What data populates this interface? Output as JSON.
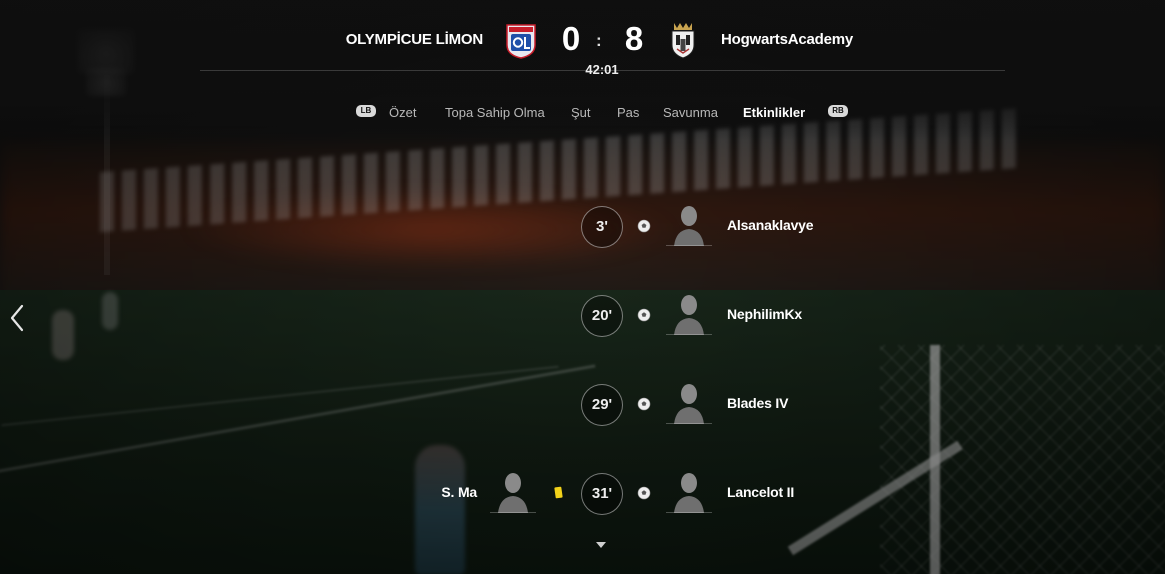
{
  "match": {
    "home_team": "OLYMPİCUE LİMON",
    "away_team": "HogwartsAcademy",
    "home_score": "0",
    "score_separator": ":",
    "away_score": "8",
    "clock": "42:01",
    "home_crest_icon": "lyon-crest-icon",
    "away_crest_icon": "castle-crest-icon"
  },
  "tabs": {
    "left_bumper": "LB",
    "right_bumper": "RB",
    "items": [
      {
        "label": "Özet"
      },
      {
        "label": "Topa Sahip Olma"
      },
      {
        "label": "Şut"
      },
      {
        "label": "Pas"
      },
      {
        "label": "Savunma"
      },
      {
        "label": "Etkinlikler"
      }
    ],
    "active_index": 5
  },
  "events": [
    {
      "minute": "3'",
      "type": "goal",
      "side": "away",
      "player": "Alsanaklavye"
    },
    {
      "minute": "20'",
      "type": "goal",
      "side": "away",
      "player": "NephilimKx"
    },
    {
      "minute": "29'",
      "type": "goal",
      "side": "away",
      "player": "Blades IV"
    },
    {
      "minute": "31'",
      "type": "goal",
      "side": "away",
      "player": "Lancelot II",
      "home_event": {
        "type": "yellow-card",
        "player": "S. Ma"
      }
    }
  ],
  "colors": {
    "yellow_card": "#f2d21a",
    "active_tab": "#ffffff",
    "inactive_tab": "#b8b8b8"
  }
}
